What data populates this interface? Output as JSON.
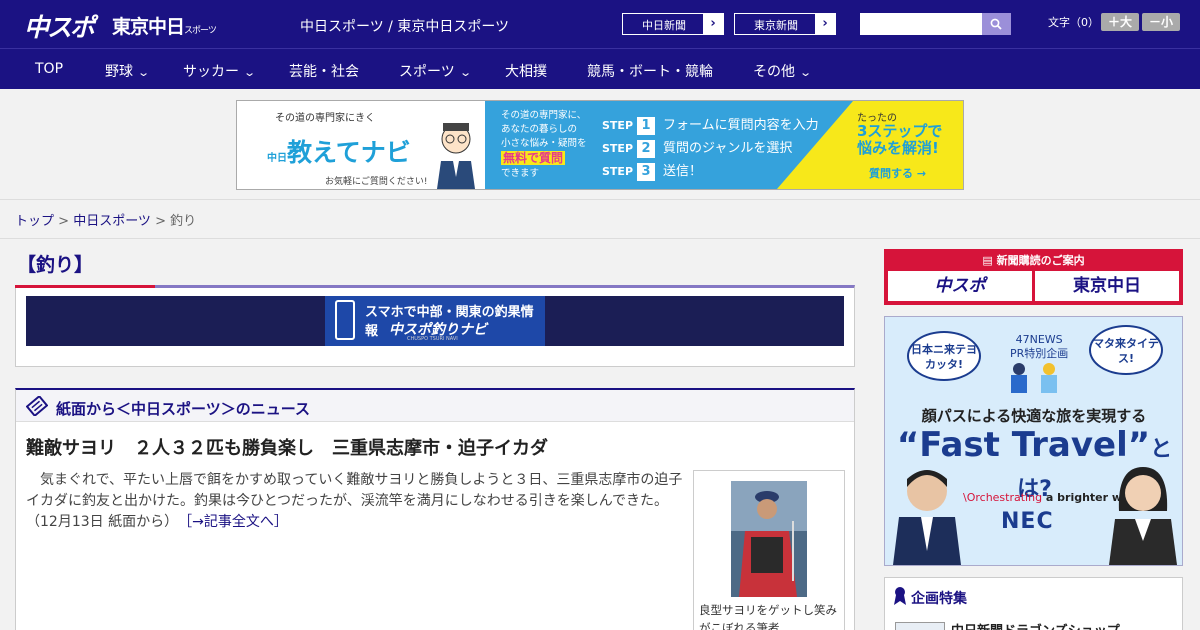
{
  "header": {
    "logo_main": "中スポ",
    "logo_tokyo": "東京中日",
    "logo_tokyo_suffix": "スポーツ",
    "site_title": "中日スポーツ / 東京中日スポーツ",
    "ext_links": [
      "中日新聞",
      "東京新聞"
    ],
    "search_placeholder": "",
    "font_size_label": "文字（0）",
    "font_bigger": "＋大",
    "font_smaller": "－小"
  },
  "nav": {
    "items": [
      {
        "label": "TOP",
        "dropdown": false
      },
      {
        "label": "野球",
        "dropdown": true
      },
      {
        "label": "サッカー",
        "dropdown": true
      },
      {
        "label": "芸能・社会",
        "dropdown": false
      },
      {
        "label": "スポーツ",
        "dropdown": true
      },
      {
        "label": "大相撲",
        "dropdown": false
      },
      {
        "label": "競馬・ボート・競輪",
        "dropdown": false
      },
      {
        "label": "その他",
        "dropdown": true
      }
    ]
  },
  "ad": {
    "tagline": "その道の専門家にきく",
    "brand_prefix": "中日",
    "brand": "教えてナビ",
    "sub": "お気軽にご質問ください!",
    "desc1": "その道の専門家に、",
    "desc2": "あなたの暮らしの",
    "desc3": "小さな悩み・疑問を",
    "free": "無料で質問",
    "desc4": "できます",
    "steps": [
      {
        "num": "1",
        "text": "フォームに質問内容を入力"
      },
      {
        "num": "2",
        "text": "質問のジャンルを選択"
      },
      {
        "num": "3",
        "text": "送信！"
      }
    ],
    "step_word": "STEP",
    "y1": "たったの",
    "y2a": "3ステップで",
    "y2b": "悩みを解消!",
    "cta": "質問する →"
  },
  "breadcrumb": {
    "top": "トップ",
    "sep": " > ",
    "site": "中日スポーツ",
    "current": "釣り"
  },
  "category_title": "【釣り】",
  "tsuri_banner": {
    "line1": "スマホで中部・関東の釣果情報",
    "line2": "中スポ釣りナビ",
    "line3": "CHUSPO TSURI NAVI"
  },
  "news_section": {
    "title": "紙面から＜中日スポーツ＞のニュース",
    "article_title": "難敵サヨリ　２人３２匹も勝負楽し　三重県志摩市・迫子イカダ",
    "article_body": "　気まぐれで、平たい上唇で餌をかすめ取っていく難敵サヨリと勝負しようと３日、三重県志摩市の迫子イカダに釣友と出かけた。釣果は今ひとつだったが、渓流竿を満月にしなわせる引きを楽しんできた。（12月13日 紙面から）　",
    "more_link": "［→記事全文へ］",
    "photo_caption": "良型サヨリをゲットし笑みがこぼれる筆者"
  },
  "sidebar": {
    "subscribe_title": "新聞購読のご案内",
    "logo1": "中スポ",
    "logo2": "東京中日",
    "ad_47": "47NEWS",
    "ad_pr": "PR特別企画",
    "bubble1": "日本ニ来テヨカッタ!",
    "bubble2": "マタ来タイデス!",
    "ad_sub": "顔パスによる快適な旅を実現する",
    "ad_fast": "“Fast Travel”",
    "ad_toha": "とは?",
    "ad_orch1": "\\Orchestrating",
    "ad_orch2": " a brighter world",
    "ad_nec": "NEC",
    "feature_title": "企画特集",
    "feature_item": "中日新聞ドラゴンズショップ"
  },
  "colors": {
    "brand_navy": "#1b1283",
    "accent_red": "#d6143a",
    "ad_blue": "#35a2dc",
    "ad_yellow": "#f7e81a"
  }
}
